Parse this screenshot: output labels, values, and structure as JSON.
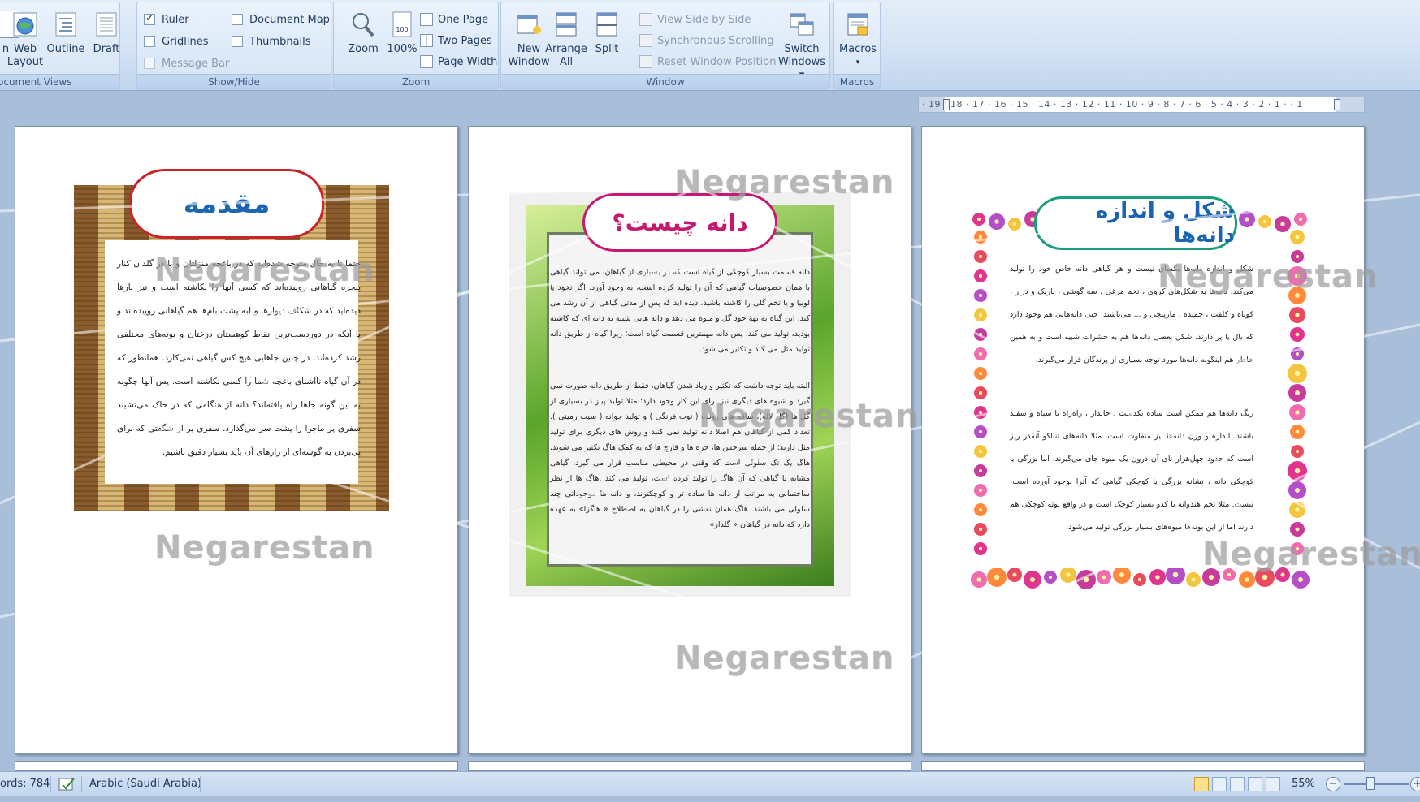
{
  "ribbon": {
    "document_views": {
      "group_label": "ocument Views",
      "buttons": [
        {
          "label_line1": "n",
          "label_line2": ""
        },
        {
          "label_line1": "Web",
          "label_line2": "Layout"
        },
        {
          "label_line1": "Outline",
          "label_line2": ""
        },
        {
          "label_line1": "Draft",
          "label_line2": ""
        }
      ]
    },
    "show_hide": {
      "group_label": "Show/Hide",
      "ruler": {
        "label": "Ruler",
        "checked": true
      },
      "gridlines": {
        "label": "Gridlines",
        "checked": false
      },
      "message_bar": {
        "label": "Message Bar",
        "checked": false
      },
      "document_map": {
        "label": "Document Map",
        "checked": false
      },
      "thumbnails": {
        "label": "Thumbnails",
        "checked": false
      }
    },
    "zoom": {
      "group_label": "Zoom",
      "zoom_label": "Zoom",
      "hundred_label": "100%",
      "one_page": "One Page",
      "two_pages": "Two Pages",
      "page_width": "Page Width"
    },
    "window": {
      "group_label": "Window",
      "new_window_1": "New",
      "new_window_2": "Window",
      "arrange_all_1": "Arrange",
      "arrange_all_2": "All",
      "split": "Split",
      "view_side_by_side": "View Side by Side",
      "synchronous_scrolling": "Synchronous Scrolling",
      "reset_window_position": "Reset Window Position",
      "switch_windows_1": "Switch",
      "switch_windows_2": "Windows ▾"
    },
    "macros": {
      "group_label": "Macros",
      "macros_label": "Macros",
      "macros_arrow": "▾"
    }
  },
  "ruler": {
    "text": "· 19 · 18 · 17 · 16 · 15 · 14 · 13 · 12 · 11 · 10 · 9 · 8 · 7 · 6 · 5 · 4 · 3 · 2 · 1 ·   · 1"
  },
  "pages": {
    "page1": {
      "title": "مقدمه",
      "body": "حتما تا به حال متوجه شده‌اید که در باغچه منزلتان و یا در گلدان کنار پنجره گیاهانی روییده‌اند که کسی آنها را نکاشته است و نیز بارها دیده‌اید که در شکاف دیوارها و لبه پشت بام‌ها هم گیاهانی روییده‌اند و یا آنکه در دوردست‌ترین نقاط کوهستان درختان و بوته‌های مختلفی رشد کرده‌اند. در چنین جاهایی هیچ کس گیاهی نمی‌کارد. همانطور که در آن گیاه ناآشنای باغچه شما را کسی نکاشته است. پس آنها چگونه به این گونه جاها راه یافته‌اند؟ دانه از هنگامی که در خاک می‌نشیند سفری پر ماجرا را پشت سر می‌گذارد. سفری پر از شگفتی که برای پی‌بردن به گوشه‌ای از رازهای آن باید بسیار دقیق باشیم."
    },
    "page2": {
      "title": "دانه چیست؟",
      "body_p1": "دانه قسمت بسیار کوچکی از گیاه است که در بسیاری از گیاهان، می تواند گیاهی با همان خصوصیات گیاهی که آن را تولید کرده است، به وجود آورد. اگر نخود یا لوبیا و یا تخم گلی را کاشته باشید، دیده اید که پس از مدتی گیاهی از آن رشد می کند. این گیاه به نهۀ خود گل و میوه می دهد و دانه هایی شبیه به دانه ای که کاشته بودید، تولید می کند. پس دانه مهمترین قسمت گیاه است؛ زیرا گیاه از طریق دانه تولید مثل می کند و تکثیر می شود.",
      "body_p2": "البته باید توجه داشت که تکثیر و زیاد شدن گیاهان، فقط از طریق دانه صورت نمی گیرد و شیوه های دیگری نیز برای این کار وجود دارد؛ مثلا تولید پیاز در بسیاری از گل ها (گل لاله)، ساقه های رونده ( توت فرنگی ) و تولید جوانه ( سیب زمینی ). تعداد کمی از گیاهان هم اصلا دانه تولید نمی کنند و روش های دیگری برای تولید مثل دارند؛ از جمله سرخس ها، خزه ها و قارچ ها که به کمک هاگ تکثیر می شوند. هاگ یک تک سلولی است که وقتی در محیطی مناسب قرار می گیرد، گیاهی مشابه با گیاهی که آن هاگ را تولید کرده است، تولید می کند .هاگ ها از نظر ساختمانی به مراتب از دانه ها ساده تر و کوچکترند، و دانه ها موجوداتی چند سلولی می باشند. هاگ همان نقشی را در گیاهان به اصطلاح « هاگزا» به عهده دارد که دانه در گیاهان « گلدار»"
    },
    "page3": {
      "title": "شکل و اندازه دانه‌ها",
      "body_p1": "شکل و اندازه دانه‌ها یکسان نیست و هر گیاهی دانه خاص خود را تولید می‌کند. دانه‌ها به شکل‌های کروی ، تخم مرغی ، سه گوشی ، باریک و دراز ، کوتاه و کلفت ، خمیده ، مارپیچی و ... می‌باشند. حتی دانه‌هایی هم وجود دارد که بال یا پر دارند. شکل بعضی دانه‌ها هم به حشرات شبیه است و به همین خاطر هم اینگونه دانه‌ها مورد توجه بسیاری از پرندگان قرار می‌گیرند.",
      "body_p2": "رنگ دانه‌ها هم ممکن است ساده یکدست ، خالدار ، راه‌راه یا سیاه و سفید باشند. اندازه و وزن دانه‌ها نیز متفاوت است. مثلا دانه‌های تنباکو آنقدر ریز است که حدود چهل‌هزار تای آن درون یک میوه جای می‌گیرند. اما بزرگی یا کوچکی دانه ، نشانه بزرگی یا کوچکی گیاهی که آنرا بوجود آورده است، نیست. مثلا تخم هندوانه یا کدو بسیار کوچک است و در واقع بوته کوچکی هم دارند اما از این بوته‌ها میوه‌های بسیار بزرگی تولید می‌شود."
    }
  },
  "watermark": {
    "text": "Negarestan"
  },
  "statusbar": {
    "words": "ords: 784",
    "language": "Arabic (Saudi Arabia)",
    "zoom_level": "55%",
    "zoom_minus": "−",
    "zoom_plus": "+"
  },
  "colors": {
    "ribbon_text": "#1e3a5f",
    "title1_border": "#c8242c",
    "title1_text": "#1d66b2",
    "title2_color": "#c5196f",
    "title3_border": "#1b9c7c",
    "title3_text": "#1a63b2"
  }
}
